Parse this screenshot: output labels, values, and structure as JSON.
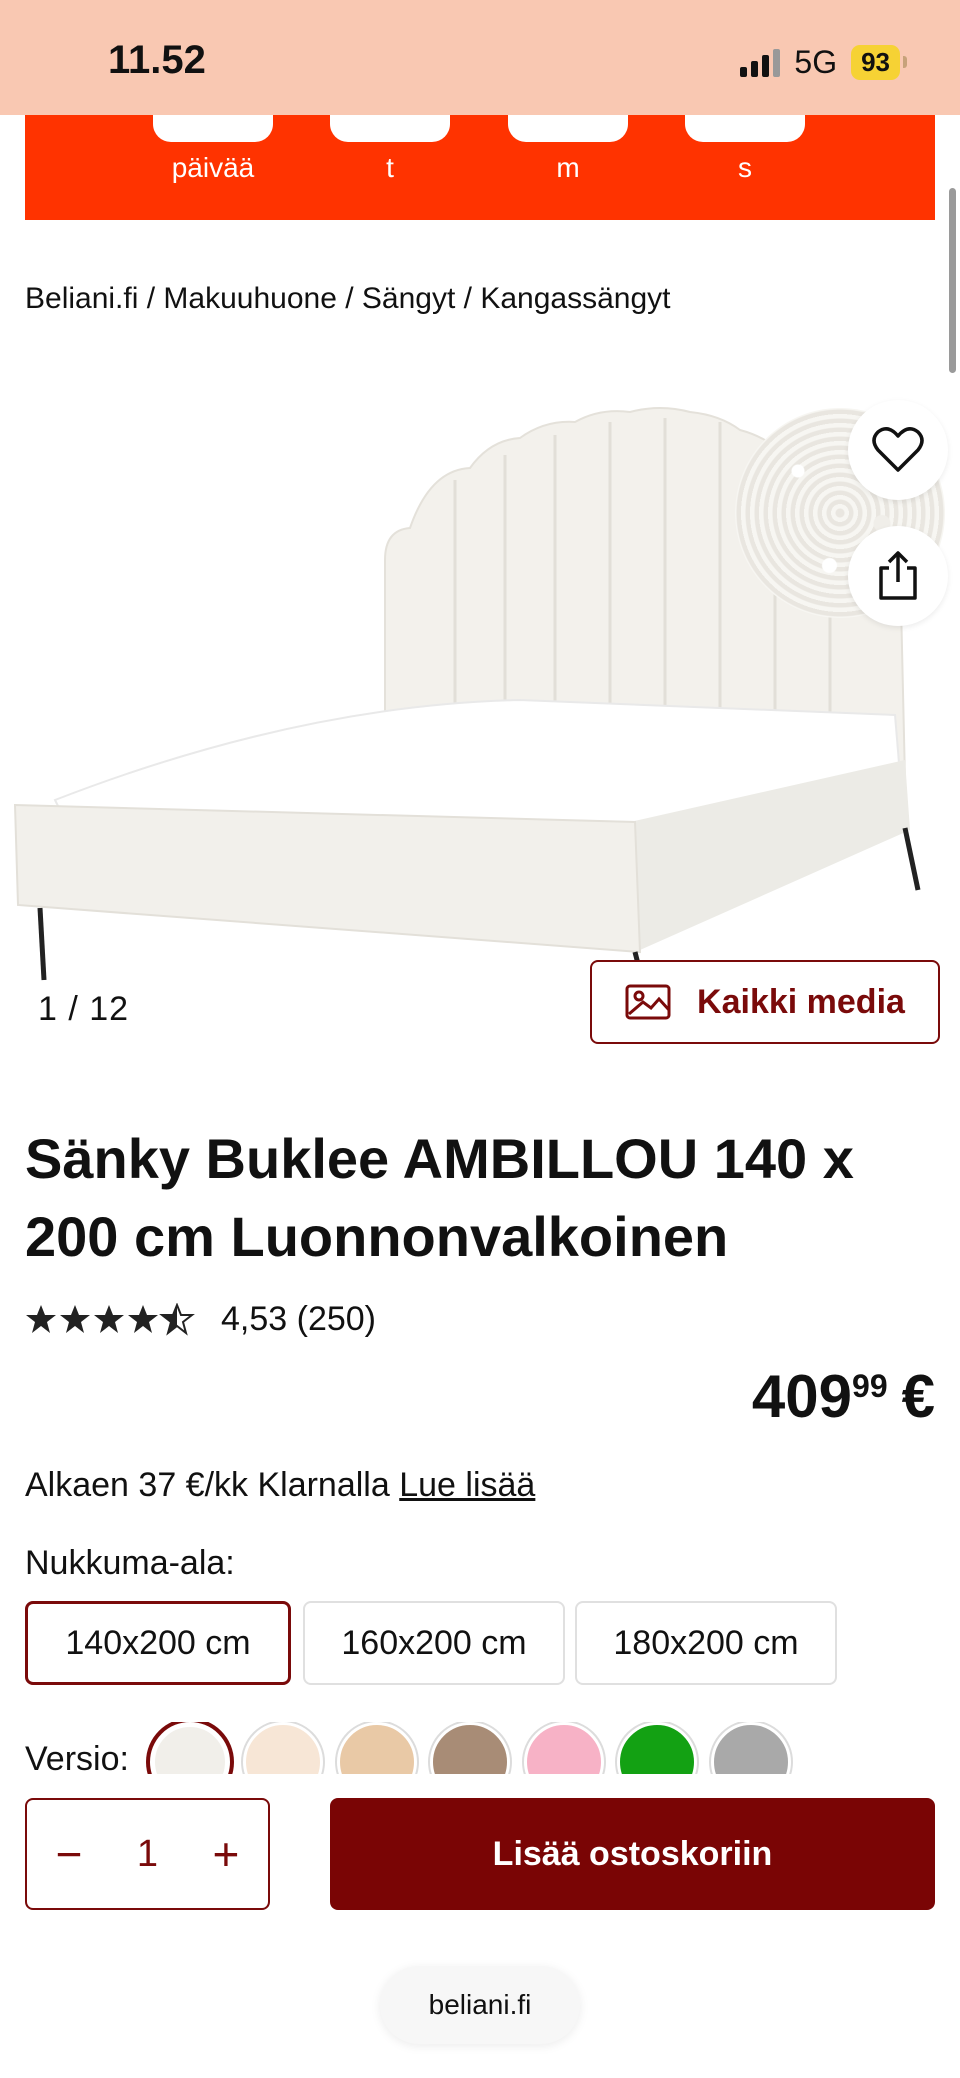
{
  "status_bar": {
    "time": "11.52",
    "network": "5G",
    "battery": "93"
  },
  "countdown": {
    "labels": [
      "päivää",
      "t",
      "m",
      "s"
    ]
  },
  "breadcrumb": {
    "items": [
      "Beliani.fi",
      "Makuuhuone",
      "Sängyt",
      "Kangassängyt"
    ],
    "separator": " / "
  },
  "gallery": {
    "counter": "1 /  12",
    "all_media_label": "Kaikki media"
  },
  "product": {
    "title": "Sänky Buklee AMBILLOU 140 x 200 cm Luonnonvalkoinen",
    "rating_value": 4.53,
    "rating_text": "4,53 (250)",
    "price_main": "409",
    "price_cents": "99",
    "currency": "€",
    "klarna_text": "Alkaen 37 €/kk Klarnalla",
    "klarna_link": "Lue lisää"
  },
  "sleep_area": {
    "label": "Nukkuma-ala:",
    "options": [
      "140x200 cm",
      "160x200 cm",
      "180x200 cm"
    ],
    "selected": "140x200 cm"
  },
  "version": {
    "label": "Versio:",
    "colors": [
      "#f1efea",
      "#f7e6d6",
      "#e9c9a6",
      "#a88c76",
      "#f7b2c6",
      "#13a113",
      "#a9a9a9"
    ]
  },
  "cart": {
    "quantity": "1",
    "minus": "−",
    "plus": "+",
    "add_label": "Lisää ostoskoriin"
  },
  "browser": {
    "url": "beliani.fi"
  },
  "colors": {
    "accent": "#7a0505",
    "countdown_bg": "#ff3300",
    "status_bg": "#f9c8b2"
  }
}
